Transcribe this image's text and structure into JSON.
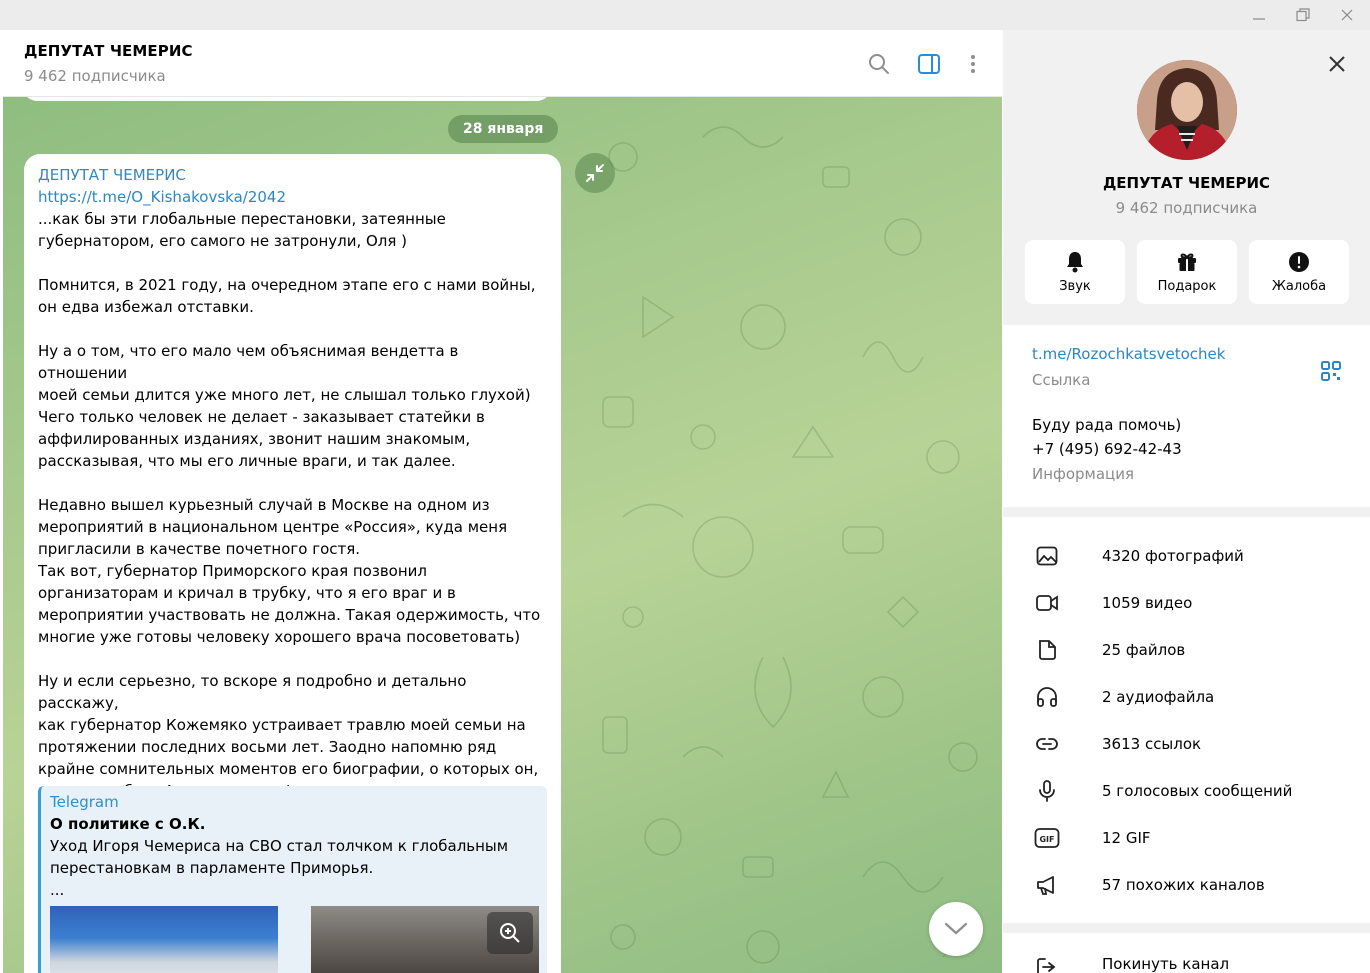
{
  "window": {
    "controls": [
      "minimize",
      "restore",
      "close"
    ]
  },
  "header": {
    "title": "ДЕПУТАТ ЧЕМЕРИС",
    "subtitle": "9 462 подписчика"
  },
  "chat": {
    "date": "28 января",
    "message": {
      "author": "ДЕПУТАТ ЧЕМЕРИС",
      "link": "https://t.me/O_Kishakovska/2042",
      "text": "...как бы эти глобальные перестановки, затеянные\nгубернатором, его самого не затронули, Оля )\n\nПомнится, в 2021 году, на очередном этапе его с нами войны,\nон едва избежал отставки.\n\nНу а о том, что его мало чем объяснимая вендетта в отношении\nмоей семьи длится уже много лет, не слышал только глухой)\nЧего только человек не делает - заказывает статейки в\nаффилированных изданиях, звонит нашим знакомым,\nрассказывая, что мы его личные враги, и так далее.\n\nНедавно вышел курьезный случай в Москве на одном из\nмероприятий в национальном центре «Россия», куда меня\nпригласили в качестве почетного гостя.\nТак вот, губернатор Приморского края позвонил\nорганизаторам и кричал в трубку, что я его враг и в\nмероприятии участвовать не должна. Такая одержимость, что\nмногие уже готовы человеку хорошего врача посоветовать)\n\nНу и если серьезно, то вскоре я подробно и детально расскажу,\nкак губернатор Кожемяко устраивает травлю моей семьи на\nпротяжении последних восьми лет. Заодно напомню ряд\nкрайне сомнительных моментов его биографии, о которых он,\nвидимо, забыл. А то эти мелкофеодальные замашки уже всех\nпорядком утомили)",
      "preview": {
        "site": "Telegram",
        "title": "О политике с О.К.",
        "description": "Уход Игоря Чемериса на СВО стал толчком к глобальным\nперестановкам в парламенте Приморья.\n..."
      }
    }
  },
  "profile": {
    "name": "ДЕПУТАТ ЧЕМЕРИС",
    "subtitle": "9 462 подписчика",
    "actions": [
      {
        "label": "Звук",
        "icon": "bell-icon"
      },
      {
        "label": "Подарок",
        "icon": "gift-icon"
      },
      {
        "label": "Жалоба",
        "icon": "report-icon"
      }
    ],
    "link": "t.me/Rozochkatsvetochek",
    "link_label": "Ссылка",
    "info": "Буду рада помочь)\n+7 (495) 692-42-43",
    "info_label": "Информация",
    "media": [
      {
        "label": "4320 фотографий",
        "icon": "photo-icon"
      },
      {
        "label": "1059 видео",
        "icon": "video-icon"
      },
      {
        "label": "25 файлов",
        "icon": "file-icon"
      },
      {
        "label": "2 аудиофайла",
        "icon": "headphones-icon"
      },
      {
        "label": "3613 ссылок",
        "icon": "link-icon"
      },
      {
        "label": "5 голосовых сообщений",
        "icon": "microphone-icon"
      },
      {
        "label": "12 GIF",
        "icon": "gif-icon"
      },
      {
        "label": "57 похожих каналов",
        "icon": "megaphone-icon"
      }
    ],
    "leave": "Покинуть канал"
  }
}
